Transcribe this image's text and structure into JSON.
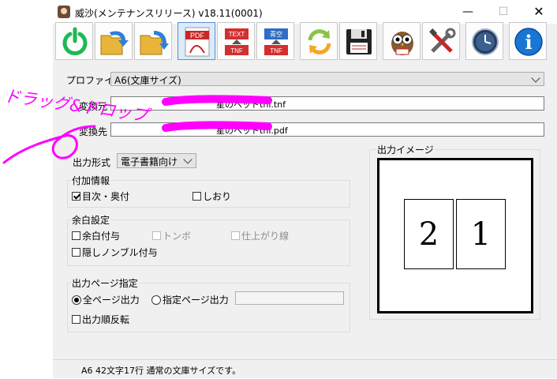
{
  "window": {
    "title": "威沙(メンテナンスリリース) v18.11(0001)",
    "minimize": "—",
    "maximize": "☐",
    "close": "✕"
  },
  "toolbar": {
    "buttons": [
      {
        "name": "power-icon"
      },
      {
        "name": "open-folder-icon"
      },
      {
        "name": "folder-return-icon"
      },
      {
        "name": "pdf-icon",
        "text": "PDF"
      },
      {
        "name": "text-tnf-icon",
        "top": "TEXT",
        "bottom": "TNF"
      },
      {
        "name": "aozora-tnf-icon",
        "top": "青空",
        "bottom": "TNF"
      },
      {
        "name": "refresh-icon"
      },
      {
        "name": "save-icon"
      },
      {
        "name": "owl-icon"
      },
      {
        "name": "tools-icon"
      },
      {
        "name": "clock-icon"
      },
      {
        "name": "info-icon",
        "text": "i"
      }
    ]
  },
  "profile": {
    "label": "プロファイル",
    "value": "A6(文庫サイズ)"
  },
  "source": {
    "label": "変換元",
    "value": "星のベッドtnf.tnf"
  },
  "dest": {
    "label": "変換先",
    "value": "星のベッドtnf.pdf"
  },
  "output_format": {
    "label": "出力形式",
    "value": "電子書籍向け"
  },
  "extra_info": {
    "title": "付加情報",
    "toc": "目次・奥付",
    "toc_checked": true,
    "bookmark": "しおり",
    "bookmark_checked": false
  },
  "margin": {
    "title": "余白設定",
    "add_margin": "余白付与",
    "tombo": "トンボ",
    "finish_line": "仕上がり線",
    "hidden_nombre": "隠しノンブル付与"
  },
  "page_spec": {
    "title": "出力ページ指定",
    "all_pages": "全ページ出力",
    "specified_pages": "指定ページ出力",
    "selected": "all",
    "specified_value": "",
    "reverse": "出力順反転"
  },
  "preview": {
    "title": "出力イメージ",
    "page_left": "2",
    "page_right": "1"
  },
  "annotation": {
    "text": "ドラッグ&ドロップ",
    "color": "#ff00ff"
  },
  "status": {
    "text": "A6 42文字17行 通常の文庫サイズです。"
  },
  "colors": {
    "window_bg": "#f0f0f0",
    "power": "#1db954",
    "pdf": "#c62828",
    "tnf": "#d32f2f",
    "info": "#1976d2"
  }
}
